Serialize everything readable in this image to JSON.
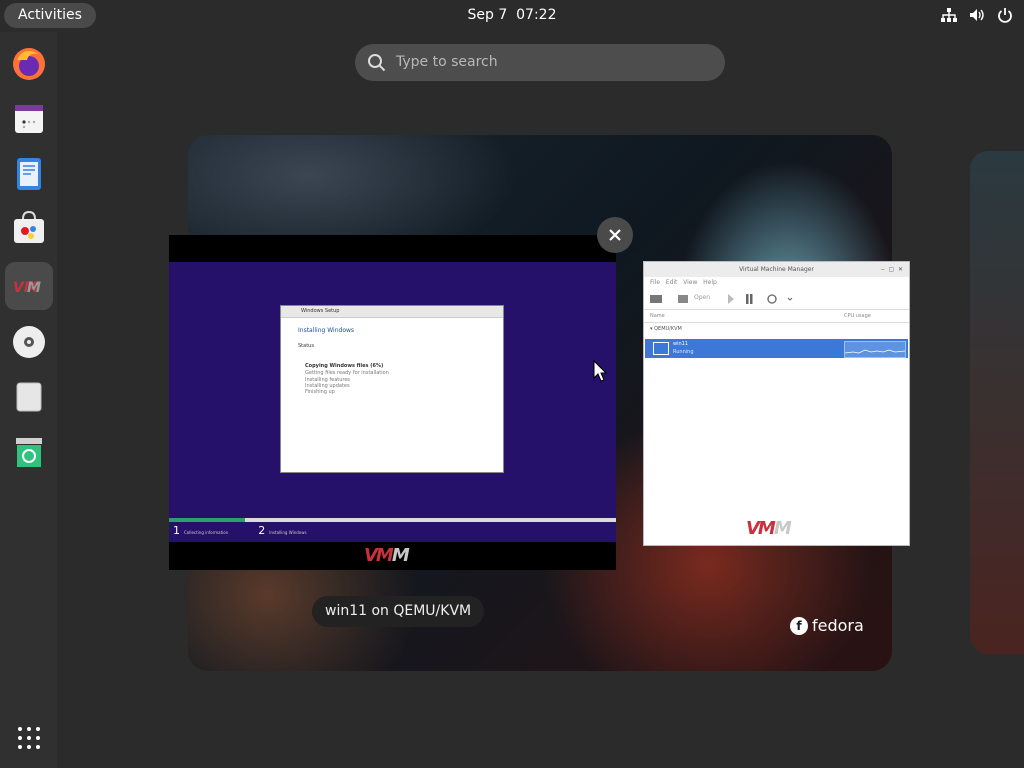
{
  "topbar": {
    "activities": "Activities",
    "date": "Sep 7",
    "time": "07:22",
    "tray_icons": [
      "network-icon",
      "volume-icon",
      "power-icon"
    ]
  },
  "dock": {
    "items": [
      {
        "name": "Firefox",
        "icon": "firefox-icon"
      },
      {
        "name": "Calendar",
        "icon": "calendar-icon"
      },
      {
        "name": "Text Editor",
        "icon": "text-editor-icon"
      },
      {
        "name": "Software",
        "icon": "software-icon"
      },
      {
        "name": "Virtual Machine Manager",
        "icon": "vmm-icon",
        "active": true
      },
      {
        "name": "Disc",
        "icon": "disc-icon"
      },
      {
        "name": "Storage",
        "icon": "storage-icon"
      },
      {
        "name": "Trash",
        "icon": "trash-icon"
      }
    ],
    "show_apps_icon": "app-grid-icon"
  },
  "search": {
    "placeholder": "Type to search"
  },
  "windows": {
    "vm_console": {
      "caption": "win11 on QEMU/KVM",
      "setup_title": "Windows Setup",
      "setup_heading": "Installing Windows",
      "setup_status": "Status",
      "setup_lines": [
        "Copying Windows files (6%)",
        "Getting files ready for installation",
        "Installing features",
        "Installing updates",
        "Finishing up"
      ],
      "progress": 0.17,
      "steps": [
        {
          "num": "1",
          "label": "Collecting information"
        },
        {
          "num": "2",
          "label": "Installing Windows"
        }
      ],
      "logo": "VM"
    },
    "vmm": {
      "title": "Virtual Machine Manager",
      "menu": [
        "File",
        "Edit",
        "View",
        "Help"
      ],
      "open_label": "Open",
      "col_name": "Name",
      "col_cpu": "CPU usage",
      "group": "QEMU/KVM",
      "vm_name": "win11",
      "vm_state": "Running",
      "logo": "VM"
    }
  },
  "wallpaper_brand": "fedora",
  "colors": {
    "accent": "#3b78d8",
    "panel": "#303030",
    "progress": "#2da06a"
  }
}
